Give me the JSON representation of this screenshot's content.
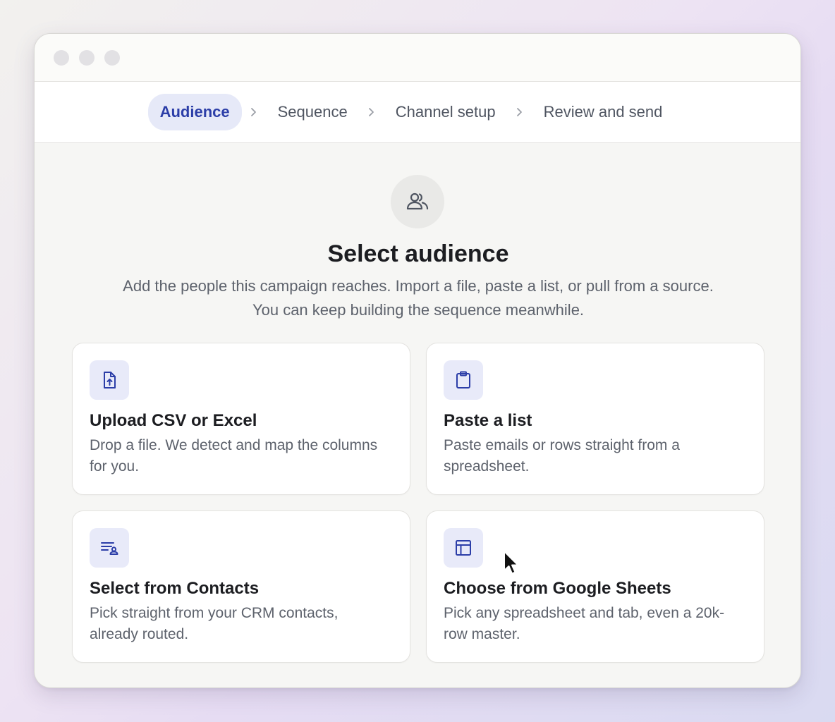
{
  "window": {
    "dots": [
      "close",
      "minimize",
      "maximize"
    ]
  },
  "stepper": {
    "steps": [
      {
        "label": "Audience",
        "active": true
      },
      {
        "label": "Sequence",
        "active": false
      },
      {
        "label": "Channel setup",
        "active": false
      },
      {
        "label": "Review and send",
        "active": false
      }
    ]
  },
  "main": {
    "icon": "users-icon",
    "title": "Select audience",
    "subtitle": "Add the people this campaign reaches. Import a file, paste a list, or pull from a source. You can keep building the sequence meanwhile."
  },
  "options": [
    {
      "icon": "file-upload-icon",
      "title": "Upload CSV or Excel",
      "description": "Drop a file. We detect and map the columns for you."
    },
    {
      "icon": "clipboard-icon",
      "title": "Paste a list",
      "description": "Paste emails or rows straight from a spreadsheet."
    },
    {
      "icon": "contacts-list-icon",
      "title": "Select from Contacts",
      "description": "Pick straight from your CRM contacts, already routed."
    },
    {
      "icon": "table-icon",
      "title": "Choose from Google Sheets",
      "description": "Pick any spreadsheet and tab, even a 20k-row master."
    }
  ],
  "colors": {
    "accent": "#2c3ea8",
    "accent_bg": "#e6e9f8",
    "text": "#1c1d21",
    "muted": "#5d626c"
  }
}
